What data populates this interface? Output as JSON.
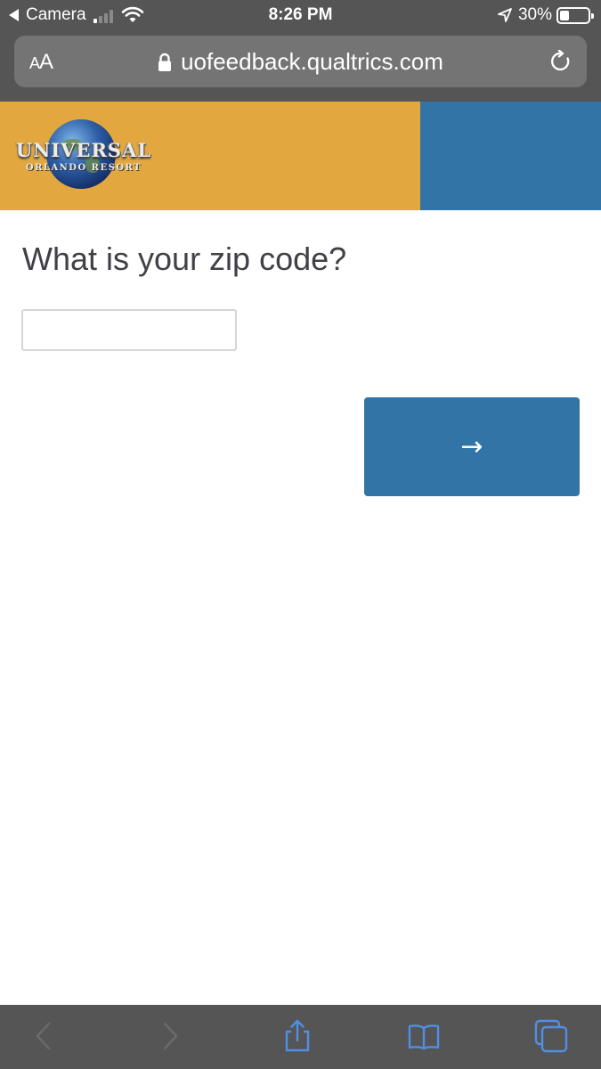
{
  "status_bar": {
    "back_app": "Camera",
    "time": "8:26 PM",
    "battery": "30%",
    "battery_level": 0.3
  },
  "browser": {
    "text_size_label_small": "A",
    "text_size_label_large": "A",
    "url": "uofeedback.qualtrics.com",
    "icons": [
      "lock-icon",
      "reload-icon",
      "back-icon",
      "forward-icon",
      "share-icon",
      "bookmarks-icon",
      "tabs-icon"
    ]
  },
  "banner": {
    "logo_text": "UNIVERSAL",
    "logo_subtext": "ORLANDO RESORT",
    "colors": {
      "gold": "#e2a73f",
      "blue": "#3174a5"
    }
  },
  "survey": {
    "question": "What is your zip code?",
    "zip_value": "",
    "next_label": "→"
  }
}
